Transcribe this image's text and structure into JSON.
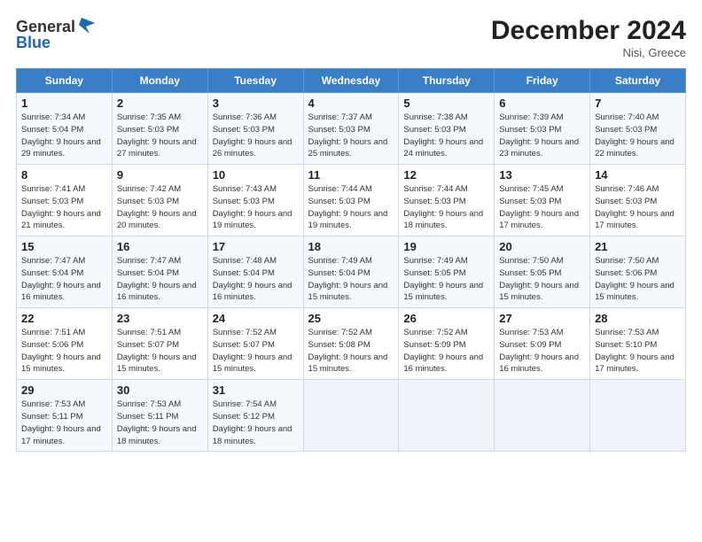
{
  "header": {
    "logo_line1": "General",
    "logo_line2": "Blue",
    "title": "December 2024",
    "location": "Nisi, Greece"
  },
  "weekdays": [
    "Sunday",
    "Monday",
    "Tuesday",
    "Wednesday",
    "Thursday",
    "Friday",
    "Saturday"
  ],
  "weeks": [
    [
      {
        "day": "1",
        "sunrise": "Sunrise: 7:34 AM",
        "sunset": "Sunset: 5:04 PM",
        "daylight": "Daylight: 9 hours and 29 minutes."
      },
      {
        "day": "2",
        "sunrise": "Sunrise: 7:35 AM",
        "sunset": "Sunset: 5:03 PM",
        "daylight": "Daylight: 9 hours and 27 minutes."
      },
      {
        "day": "3",
        "sunrise": "Sunrise: 7:36 AM",
        "sunset": "Sunset: 5:03 PM",
        "daylight": "Daylight: 9 hours and 26 minutes."
      },
      {
        "day": "4",
        "sunrise": "Sunrise: 7:37 AM",
        "sunset": "Sunset: 5:03 PM",
        "daylight": "Daylight: 9 hours and 25 minutes."
      },
      {
        "day": "5",
        "sunrise": "Sunrise: 7:38 AM",
        "sunset": "Sunset: 5:03 PM",
        "daylight": "Daylight: 9 hours and 24 minutes."
      },
      {
        "day": "6",
        "sunrise": "Sunrise: 7:39 AM",
        "sunset": "Sunset: 5:03 PM",
        "daylight": "Daylight: 9 hours and 23 minutes."
      },
      {
        "day": "7",
        "sunrise": "Sunrise: 7:40 AM",
        "sunset": "Sunset: 5:03 PM",
        "daylight": "Daylight: 9 hours and 22 minutes."
      }
    ],
    [
      {
        "day": "8",
        "sunrise": "Sunrise: 7:41 AM",
        "sunset": "Sunset: 5:03 PM",
        "daylight": "Daylight: 9 hours and 21 minutes."
      },
      {
        "day": "9",
        "sunrise": "Sunrise: 7:42 AM",
        "sunset": "Sunset: 5:03 PM",
        "daylight": "Daylight: 9 hours and 20 minutes."
      },
      {
        "day": "10",
        "sunrise": "Sunrise: 7:43 AM",
        "sunset": "Sunset: 5:03 PM",
        "daylight": "Daylight: 9 hours and 19 minutes."
      },
      {
        "day": "11",
        "sunrise": "Sunrise: 7:44 AM",
        "sunset": "Sunset: 5:03 PM",
        "daylight": "Daylight: 9 hours and 19 minutes."
      },
      {
        "day": "12",
        "sunrise": "Sunrise: 7:44 AM",
        "sunset": "Sunset: 5:03 PM",
        "daylight": "Daylight: 9 hours and 18 minutes."
      },
      {
        "day": "13",
        "sunrise": "Sunrise: 7:45 AM",
        "sunset": "Sunset: 5:03 PM",
        "daylight": "Daylight: 9 hours and 17 minutes."
      },
      {
        "day": "14",
        "sunrise": "Sunrise: 7:46 AM",
        "sunset": "Sunset: 5:03 PM",
        "daylight": "Daylight: 9 hours and 17 minutes."
      }
    ],
    [
      {
        "day": "15",
        "sunrise": "Sunrise: 7:47 AM",
        "sunset": "Sunset: 5:04 PM",
        "daylight": "Daylight: 9 hours and 16 minutes."
      },
      {
        "day": "16",
        "sunrise": "Sunrise: 7:47 AM",
        "sunset": "Sunset: 5:04 PM",
        "daylight": "Daylight: 9 hours and 16 minutes."
      },
      {
        "day": "17",
        "sunrise": "Sunrise: 7:48 AM",
        "sunset": "Sunset: 5:04 PM",
        "daylight": "Daylight: 9 hours and 16 minutes."
      },
      {
        "day": "18",
        "sunrise": "Sunrise: 7:49 AM",
        "sunset": "Sunset: 5:04 PM",
        "daylight": "Daylight: 9 hours and 15 minutes."
      },
      {
        "day": "19",
        "sunrise": "Sunrise: 7:49 AM",
        "sunset": "Sunset: 5:05 PM",
        "daylight": "Daylight: 9 hours and 15 minutes."
      },
      {
        "day": "20",
        "sunrise": "Sunrise: 7:50 AM",
        "sunset": "Sunset: 5:05 PM",
        "daylight": "Daylight: 9 hours and 15 minutes."
      },
      {
        "day": "21",
        "sunrise": "Sunrise: 7:50 AM",
        "sunset": "Sunset: 5:06 PM",
        "daylight": "Daylight: 9 hours and 15 minutes."
      }
    ],
    [
      {
        "day": "22",
        "sunrise": "Sunrise: 7:51 AM",
        "sunset": "Sunset: 5:06 PM",
        "daylight": "Daylight: 9 hours and 15 minutes."
      },
      {
        "day": "23",
        "sunrise": "Sunrise: 7:51 AM",
        "sunset": "Sunset: 5:07 PM",
        "daylight": "Daylight: 9 hours and 15 minutes."
      },
      {
        "day": "24",
        "sunrise": "Sunrise: 7:52 AM",
        "sunset": "Sunset: 5:07 PM",
        "daylight": "Daylight: 9 hours and 15 minutes."
      },
      {
        "day": "25",
        "sunrise": "Sunrise: 7:52 AM",
        "sunset": "Sunset: 5:08 PM",
        "daylight": "Daylight: 9 hours and 15 minutes."
      },
      {
        "day": "26",
        "sunrise": "Sunrise: 7:52 AM",
        "sunset": "Sunset: 5:09 PM",
        "daylight": "Daylight: 9 hours and 16 minutes."
      },
      {
        "day": "27",
        "sunrise": "Sunrise: 7:53 AM",
        "sunset": "Sunset: 5:09 PM",
        "daylight": "Daylight: 9 hours and 16 minutes."
      },
      {
        "day": "28",
        "sunrise": "Sunrise: 7:53 AM",
        "sunset": "Sunset: 5:10 PM",
        "daylight": "Daylight: 9 hours and 17 minutes."
      }
    ],
    [
      {
        "day": "29",
        "sunrise": "Sunrise: 7:53 AM",
        "sunset": "Sunset: 5:11 PM",
        "daylight": "Daylight: 9 hours and 17 minutes."
      },
      {
        "day": "30",
        "sunrise": "Sunrise: 7:53 AM",
        "sunset": "Sunset: 5:11 PM",
        "daylight": "Daylight: 9 hours and 18 minutes."
      },
      {
        "day": "31",
        "sunrise": "Sunrise: 7:54 AM",
        "sunset": "Sunset: 5:12 PM",
        "daylight": "Daylight: 9 hours and 18 minutes."
      },
      null,
      null,
      null,
      null
    ]
  ]
}
